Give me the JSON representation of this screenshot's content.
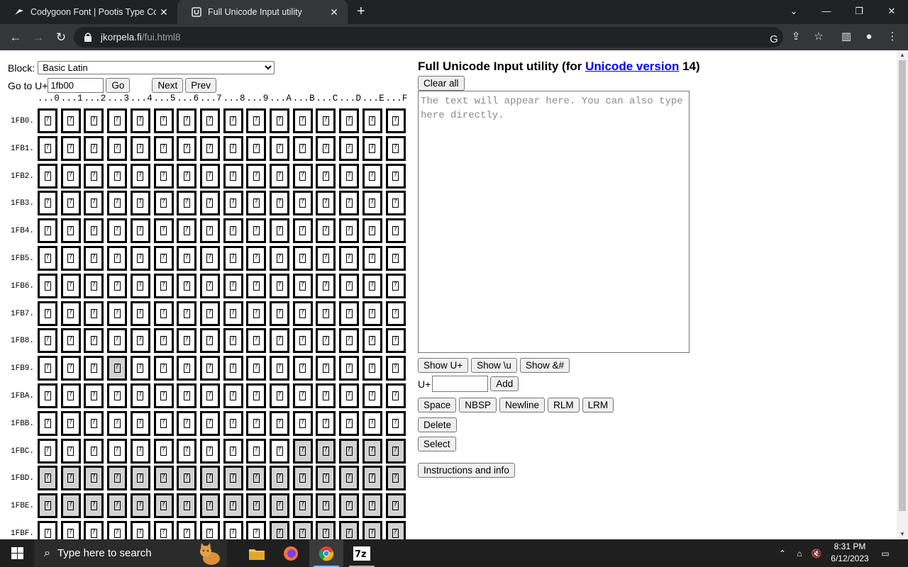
{
  "browser": {
    "tabs": [
      {
        "title": "Codygoon Font | Pootis Type Co",
        "active": false
      },
      {
        "title": "Full Unicode Input utility",
        "active": true
      }
    ],
    "url_host": "jkorpela.fi",
    "url_path": "/fui.html8"
  },
  "page": {
    "block_label": "Block:",
    "block_selected": "Basic Latin",
    "goto_label": "Go to U+",
    "goto_value": "1fb00",
    "go_button": "Go",
    "next_button": "Next",
    "prev_button": "Prev",
    "grid": {
      "col_headers": [
        "...0",
        "...1",
        "...2",
        "...3",
        "...4",
        "...5",
        "...6",
        "...7",
        "...8",
        "...9",
        "...A",
        "...B",
        "...C",
        "...D",
        "...E",
        "...F"
      ],
      "rows": [
        {
          "label": "1FB0.",
          "unassigned": []
        },
        {
          "label": "1FB1.",
          "unassigned": []
        },
        {
          "label": "1FB2.",
          "unassigned": []
        },
        {
          "label": "1FB3.",
          "unassigned": []
        },
        {
          "label": "1FB4.",
          "unassigned": []
        },
        {
          "label": "1FB5.",
          "unassigned": []
        },
        {
          "label": "1FB6.",
          "unassigned": []
        },
        {
          "label": "1FB7.",
          "unassigned": []
        },
        {
          "label": "1FB8.",
          "unassigned": []
        },
        {
          "label": "1FB9.",
          "unassigned": [
            3
          ]
        },
        {
          "label": "1FBA.",
          "unassigned": []
        },
        {
          "label": "1FBB.",
          "unassigned": []
        },
        {
          "label": "1FBC.",
          "unassigned": [
            11,
            12,
            13,
            14,
            15
          ]
        },
        {
          "label": "1FBD.",
          "unassigned": [
            0,
            1,
            2,
            3,
            4,
            5,
            6,
            7,
            8,
            9,
            10,
            11,
            12,
            13,
            14,
            15
          ]
        },
        {
          "label": "1FBE.",
          "unassigned": [
            0,
            1,
            2,
            3,
            4,
            5,
            6,
            7,
            8,
            9,
            10,
            11,
            12,
            13,
            14,
            15
          ]
        },
        {
          "label": "1FBF.",
          "unassigned": [
            10,
            11,
            12,
            13,
            14,
            15
          ]
        }
      ]
    },
    "title_prefix": "Full Unicode Input utility (for ",
    "title_link": "Unicode version",
    "title_suffix": " 14)",
    "clear_all": "Clear all",
    "textarea_placeholder": "The text will appear here. You can also type here directly.",
    "show_buttons": [
      "Show U+",
      "Show \\u",
      "Show &#"
    ],
    "add_label": "U+",
    "add_button": "Add",
    "char_buttons": [
      "Space",
      "NBSP",
      "Newline",
      "RLM",
      "LRM"
    ],
    "delete_button": "Delete",
    "select_button": "Select",
    "instructions_button": "Instructions and info"
  },
  "taskbar": {
    "search_placeholder": "Type here to search",
    "time": "8:31 PM",
    "date": "6/12/2023"
  }
}
